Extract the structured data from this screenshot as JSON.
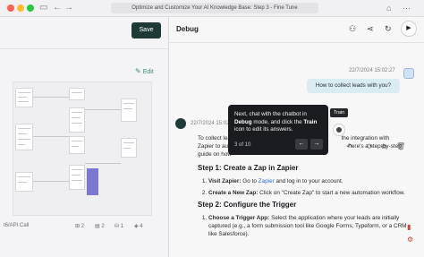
{
  "window": {
    "url_title": "Optimize and Customize Your AI Knowledge Base: Step 3 - Fine Tune",
    "nav_back": "←",
    "nav_forward": "→",
    "sidebar_icon": "▭",
    "right_icons": [
      "⌂",
      "⋯"
    ]
  },
  "left_panel": {
    "save_label": "Save",
    "edit_label": "Edit",
    "canvas_caption": "t6/API Call",
    "stats": [
      {
        "icon": "node-icon",
        "glyph": "⊞",
        "value": "2"
      },
      {
        "icon": "doc-icon",
        "glyph": "▤",
        "value": "2"
      },
      {
        "icon": "db-icon",
        "glyph": "⛁",
        "value": "1"
      },
      {
        "icon": "layer-icon",
        "glyph": "◈",
        "value": "4"
      }
    ]
  },
  "debug_panel": {
    "title": "Debug",
    "icons": {
      "user": "user-icon",
      "share": "share-icon",
      "refresh": "refresh-icon",
      "play": "play-icon"
    }
  },
  "chat": {
    "user_timestamp": "22/7/2024 15:02:27",
    "user_message": "How to collect leads with you?",
    "bot_timestamp": "22/7/2024 15:02:28",
    "answer": {
      "intro_prefix": "To collect lea",
      "intro_mid": "the integration with",
      "intro_line2_prefix": "Zapier to autom",
      "intro_line2_suffix": "here's a step-by-step",
      "intro_line3": "guide on how",
      "step1_heading": "Step 1: Create a Zap in Zapier",
      "step1_items": [
        {
          "label": "Visit Zapier:",
          "text_a": " Go to ",
          "link": "Zapier",
          "text_b": " and log in to your account."
        },
        {
          "label": "Create a New Zap:",
          "text_a": " Click on \"Create Zap\" to start a new automation workflow.",
          "link": "",
          "text_b": ""
        }
      ],
      "step2_heading": "Step 2: Configure the Trigger",
      "step2_items": [
        {
          "label": "Choose a Trigger App:",
          "text_a": " Select the application where your leads are initially captured (e.g., a form submission tool like Google Forms, Typeform, or a CRM like Salesforce).",
          "link": "",
          "text_b": ""
        }
      ]
    }
  },
  "tour": {
    "text_1": "Next, chat with the chatbot in ",
    "debug_word": "Debug",
    "text_2": " mode, and click the ",
    "train_word": "Train",
    "text_3": " icon to edit its answers.",
    "counter": "3 of 10",
    "prev": "←",
    "next": "→",
    "tooltip_label": "Train"
  }
}
